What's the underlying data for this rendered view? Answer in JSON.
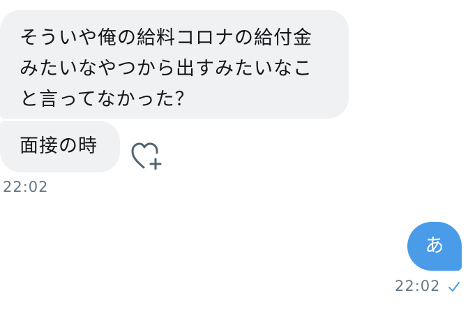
{
  "conversation": {
    "received": [
      {
        "lines": [
          "そういや俺の給料コロナの給付金",
          "みたいなやつから出すみたいなこ",
          "と言ってなかった？"
        ]
      },
      {
        "lines": [
          "面接の時"
        ]
      }
    ],
    "received_time": "22:02",
    "sent": [
      {
        "text": "あ"
      }
    ],
    "sent_time": "22:02"
  },
  "icons": {
    "react": "heart-plus-icon",
    "read_receipt": "checkmark-icon"
  },
  "colors": {
    "incoming_bubble": "#eff1f3",
    "outgoing_bubble": "#4a9be8",
    "timestamp": "#657786",
    "text": "#14171a"
  }
}
